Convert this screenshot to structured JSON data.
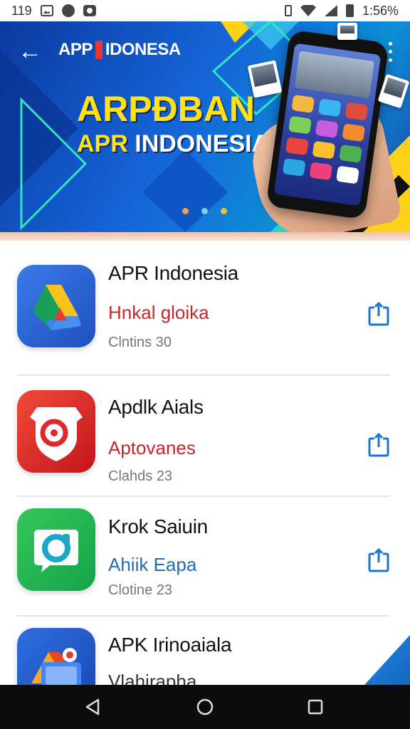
{
  "status_bar": {
    "left_text": "119",
    "time": "1:56%",
    "icons": [
      "gallery-icon",
      "chat-icon",
      "camera-icon",
      "vibrate-icon",
      "wifi-icon",
      "signal-icon",
      "battery-icon"
    ]
  },
  "header": {
    "back_icon": "arrow-left-icon",
    "brand_part1": "APP ",
    "brand_part2": "IDONESA",
    "menu_icon": "more-vertical-icon"
  },
  "banner": {
    "headline_line1": "ARPƉBAN",
    "headline_line2_a": "APR",
    "headline_line2_b": " INDONESIA",
    "carousel_dots": [
      "#f0a050",
      "#7ad0e8",
      "#e8c030"
    ]
  },
  "apps": [
    {
      "title": "APR Indonesia",
      "subtitle": "Hnkal gloika",
      "subtitle_color": "#c62828",
      "meta": "Clntins 30",
      "icon": "drive-triangle-icon"
    },
    {
      "title": "Apdlk Aials",
      "subtitle": "Aptovanes",
      "subtitle_color": "#c62828",
      "meta": "Clahds 23",
      "icon": "shield-icon"
    },
    {
      "title": "Krok Saiuin",
      "subtitle": "Ahiik Eapa",
      "subtitle_color": "#1f6fb0",
      "meta": "Clotine 23",
      "icon": "chat-bubble-icon"
    },
    {
      "title": "APK Irinoaiala",
      "subtitle": "Vlahirapha",
      "subtitle_color": "#333333",
      "meta": "",
      "icon": "folder-drive-icon"
    }
  ],
  "nav": {
    "back_icon": "nav-back-icon",
    "home_icon": "nav-home-icon",
    "recents_icon": "nav-recents-icon"
  },
  "colors": {
    "banner_primary": "#1565d8",
    "accent_yellow": "#ffe21a",
    "share_icon": "#1976d2"
  }
}
